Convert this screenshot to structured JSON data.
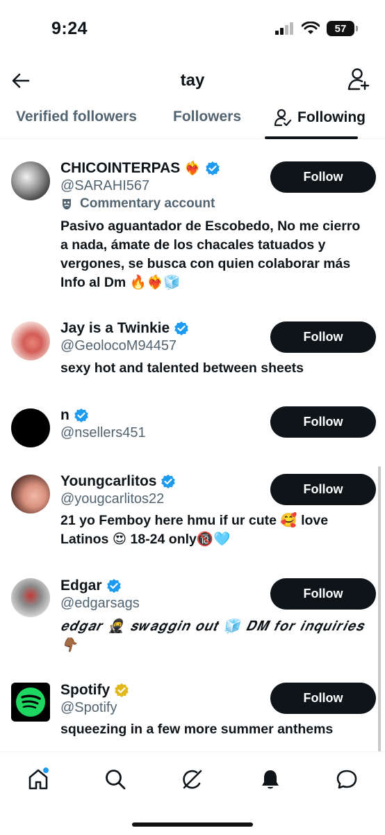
{
  "status": {
    "time": "9:24",
    "battery": "57"
  },
  "header": {
    "title": "tay"
  },
  "tabs": [
    {
      "label": "Verified followers"
    },
    {
      "label": "Followers"
    },
    {
      "label": "Following"
    }
  ],
  "users": [
    {
      "name": "CHICOINTERPAS",
      "name_emoji": "❤️‍🔥",
      "handle": "@SARAHI567",
      "label": "Commentary account",
      "bio": "Pasivo aguantador de Escobedo, No me cierro a nada, ámate de los chacales tatuados y vergones, se busca con quien colaborar más Info al Dm 🔥❤️‍🔥🧊",
      "follow_label": "Follow",
      "badge": "blue"
    },
    {
      "name": "Jay is a Twinkie",
      "handle": "@GeolocoM94457",
      "bio": "sexy hot and talented between sheets",
      "follow_label": "Follow",
      "badge": "blue"
    },
    {
      "name": "n",
      "handle": "@nsellers451",
      "follow_label": "Follow",
      "badge": "blue"
    },
    {
      "name": "Youngcarlitos",
      "handle": "@yougcarlitos22",
      "bio": "21 yo Femboy here hmu if ur cute 🥰 love Latinos 😍 18-24 only🔞🩵",
      "follow_label": "Follow",
      "badge": "blue"
    },
    {
      "name": "Edgar",
      "handle": "@edgarsags",
      "bio": "𝒆𝒅𝒈𝒂𝒓 🥷 𝒔𝒘𝒂𝒈𝒈𝒊𝒏 𝒐𝒖𝒕 🧊 𝑫𝑴 𝒇𝒐𝒓 𝒊𝒏𝒒𝒖𝒊𝒓𝒊𝒆𝒔 👇🏾",
      "follow_label": "Follow",
      "badge": "blue"
    },
    {
      "name": "Spotify",
      "handle": "@Spotify",
      "bio": "squeezing in a few more summer anthems",
      "follow_label": "Follow",
      "badge": "gold"
    }
  ],
  "colors": {
    "accent": "#1d9bf0",
    "gold": "#e2b719",
    "text": "#0f1419",
    "muted": "#536471",
    "spotify": "#1ed760"
  },
  "nav": [
    {
      "icon": "home-icon"
    },
    {
      "icon": "search-icon"
    },
    {
      "icon": "grok-icon"
    },
    {
      "icon": "bell-icon"
    },
    {
      "icon": "chat-icon"
    }
  ]
}
